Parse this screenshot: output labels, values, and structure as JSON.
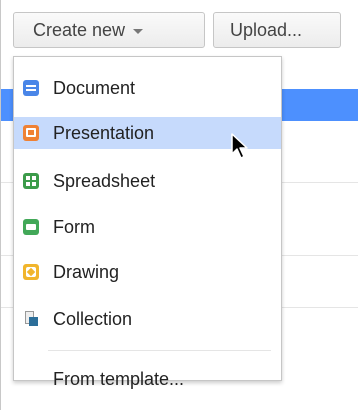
{
  "toolbar": {
    "create_new_label": "Create new",
    "upload_label": "Upload..."
  },
  "menu": {
    "items": [
      {
        "label": "Document",
        "icon": "document-icon",
        "color": "#4a86e8"
      },
      {
        "label": "Presentation",
        "icon": "presentation-icon",
        "color": "#ef8134",
        "highlighted": true
      },
      {
        "label": "Spreadsheet",
        "icon": "spreadsheet-icon",
        "color": "#3c9b4a"
      },
      {
        "label": "Form",
        "icon": "form-icon",
        "color": "#42a858"
      },
      {
        "label": "Drawing",
        "icon": "drawing-icon",
        "color": "#f1b52c"
      },
      {
        "label": "Collection",
        "icon": "collection-icon",
        "color": "#2c6e99"
      }
    ],
    "footer_item": {
      "label": "From template..."
    },
    "highlight_color": "#c6dafc"
  }
}
